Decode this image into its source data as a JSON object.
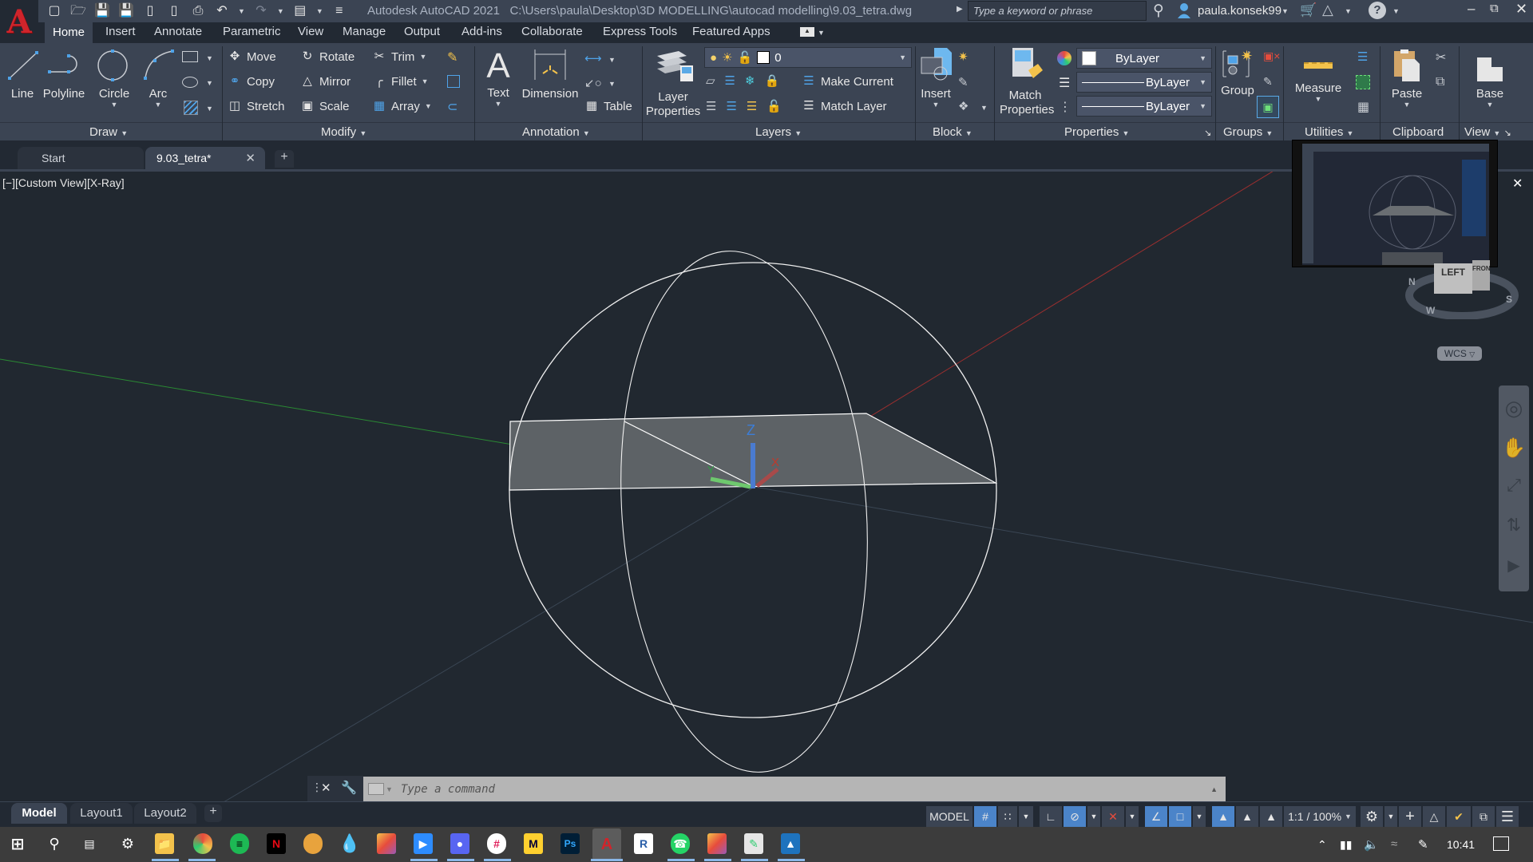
{
  "app": {
    "title": "Autodesk AutoCAD 2021",
    "file_path": "C:\\Users\\paula\\Desktop\\3D MODELLING\\autocad modelling\\9.03_tetra.dwg",
    "search_placeholder": "Type a keyword or phrase",
    "user": "paula.konsek99",
    "logo_letter": "A"
  },
  "quick_access": [
    "new-icon",
    "open-icon",
    "save-icon",
    "save-as-icon",
    "open-from-web-icon",
    "save-to-web-icon",
    "plot-icon",
    "undo-icon",
    "redo-icon",
    "workspace-icon",
    "customize-icon"
  ],
  "menu_tabs": [
    "Home",
    "Insert",
    "Annotate",
    "Parametric",
    "View",
    "Manage",
    "Output",
    "Add-ins",
    "Collaborate",
    "Express Tools",
    "Featured Apps"
  ],
  "active_tab": "Home",
  "ribbon": {
    "draw": {
      "title": "Draw",
      "line": "Line",
      "polyline": "Polyline",
      "circle": "Circle",
      "arc": "Arc"
    },
    "modify": {
      "title": "Modify",
      "move": "Move",
      "rotate": "Rotate",
      "trim": "Trim",
      "copy": "Copy",
      "mirror": "Mirror",
      "fillet": "Fillet",
      "stretch": "Stretch",
      "scale": "Scale",
      "array": "Array"
    },
    "annotation": {
      "title": "Annotation",
      "text": "Text",
      "dimension": "Dimension",
      "table": "Table"
    },
    "layers": {
      "title": "Layers",
      "layer_properties_1": "Layer",
      "layer_properties_2": "Properties",
      "current_layer": "0",
      "make_current": "Make Current",
      "match_layer": "Match Layer"
    },
    "block": {
      "title": "Block",
      "insert": "Insert"
    },
    "properties": {
      "title": "Properties",
      "match_1": "Match",
      "match_2": "Properties",
      "color": "ByLayer",
      "lineweight": "ByLayer",
      "linetype": "ByLayer"
    },
    "groups": {
      "title": "Groups",
      "group": "Group"
    },
    "utilities": {
      "title": "Utilities",
      "measure": "Measure"
    },
    "clipboard": {
      "title": "Clipboard",
      "paste": "Paste"
    },
    "view": {
      "title": "View",
      "base": "Base"
    }
  },
  "doc_tabs": [
    {
      "label": "Start",
      "active": false
    },
    {
      "label": "9.03_tetra*",
      "active": true
    }
  ],
  "viewport": {
    "label": "[−][Custom View][X-Ray]",
    "viewcube_face_left": "LEFT",
    "viewcube_face_front": "FRONT",
    "compass": [
      "N",
      "S",
      "W"
    ],
    "wcs": "WCS",
    "ucs_labels": {
      "x": "X",
      "y": "Y",
      "z": "Z"
    }
  },
  "command_line": {
    "placeholder": "Type a command"
  },
  "layout_tabs": [
    "Model",
    "Layout1",
    "Layout2"
  ],
  "active_layout": "Model",
  "status_bar": {
    "model": "MODEL",
    "scale": "1:1 / 100%"
  },
  "taskbar": {
    "apps": [
      "windows-start",
      "search",
      "task-view",
      "settings",
      "file-explorer",
      "chrome",
      "spotify",
      "netflix",
      "app-circle",
      "app-drop",
      "creative-cloud",
      "zoom",
      "discord",
      "slack",
      "miro",
      "photoshop",
      "autocad",
      "revit",
      "whatsapp",
      "creative-cloud-2",
      "notepad-app",
      "photos"
    ],
    "active_app": "autocad",
    "time": "10:41"
  },
  "colors": {
    "accent": "#4b84c9",
    "viewport_bg": "#212830",
    "ribbon_bg": "#3b4453",
    "x_axis": "#c0392b",
    "y_axis": "#2ea043",
    "z_axis": "#3b7dd8"
  }
}
